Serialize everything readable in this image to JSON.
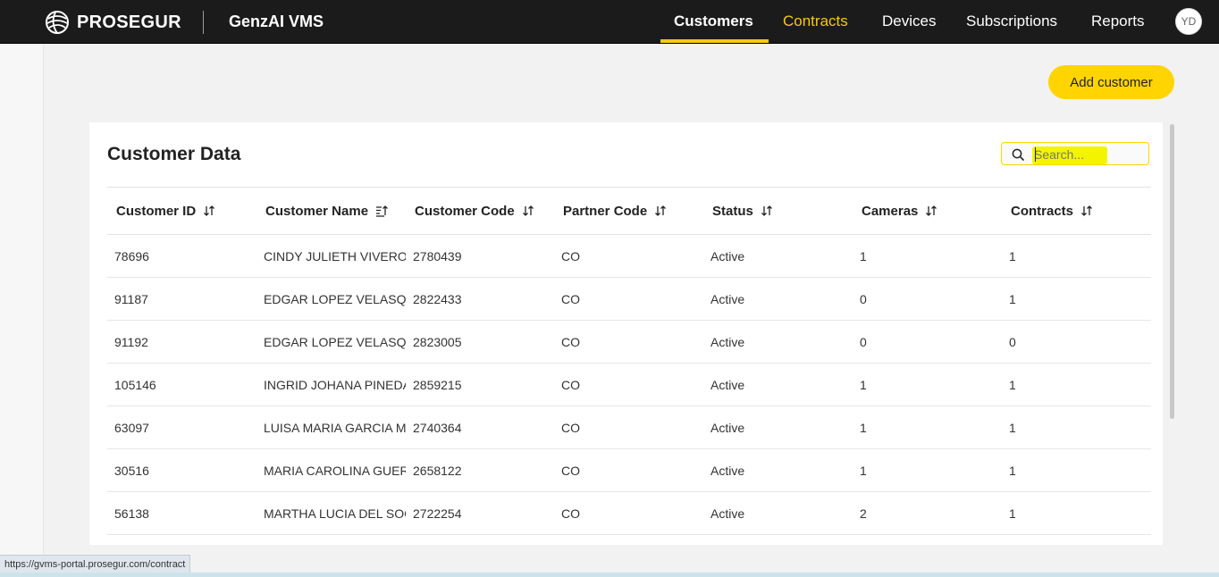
{
  "brand": {
    "name": "PROSEGUR",
    "app": "GenzAI VMS"
  },
  "nav": {
    "items": [
      {
        "label": "Customers"
      },
      {
        "label": "Contracts"
      },
      {
        "label": "Devices"
      },
      {
        "label": "Subscriptions"
      },
      {
        "label": "Reports"
      }
    ],
    "active": "Customers",
    "hovered": "Contracts",
    "avatar": "YD"
  },
  "actions": {
    "add_customer": "Add customer"
  },
  "card": {
    "title": "Customer Data"
  },
  "search": {
    "placeholder": "Search..."
  },
  "table": {
    "columns": [
      "Customer ID",
      "Customer Name",
      "Customer Code",
      "Partner Code",
      "Status",
      "Cameras",
      "Contracts"
    ],
    "rows": [
      [
        "78696",
        "CINDY JULIETH VIVEROS",
        "2780439",
        "CO",
        "Active",
        "1",
        "1"
      ],
      [
        "91187",
        "EDGAR LOPEZ VELASQUE",
        "2822433",
        "CO",
        "Active",
        "0",
        "1"
      ],
      [
        "91192",
        "EDGAR LOPEZ VELASQUE",
        "2823005",
        "CO",
        "Active",
        "0",
        "0"
      ],
      [
        "105146",
        "INGRID JOHANA PINEDA",
        "2859215",
        "CO",
        "Active",
        "1",
        "1"
      ],
      [
        "63097",
        "LUISA MARIA GARCIA MC",
        "2740364",
        "CO",
        "Active",
        "1",
        "1"
      ],
      [
        "30516",
        "MARIA CAROLINA GUERF",
        "2658122",
        "CO",
        "Active",
        "1",
        "1"
      ],
      [
        "56138",
        "MARTHA LUCIA DEL SOC",
        "2722254",
        "CO",
        "Active",
        "2",
        "1"
      ]
    ]
  },
  "status_bar": {
    "url": "https://gvms-portal.prosegur.com/contract"
  },
  "colors": {
    "accent": "#ffd400",
    "topbar": "#1b1b1b",
    "highlight": "#f3f500"
  }
}
